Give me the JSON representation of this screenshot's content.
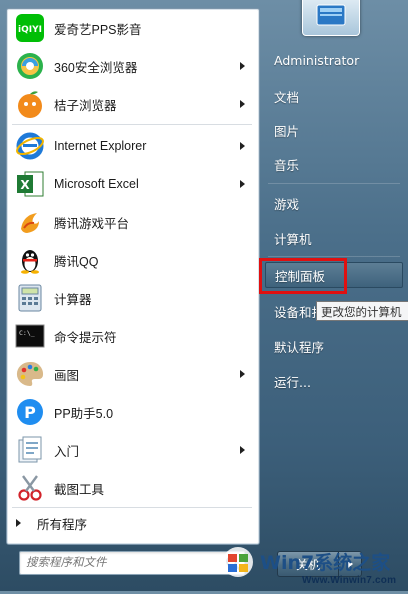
{
  "left_pane": {
    "programs": [
      {
        "id": "iqiyi",
        "label": "爱奇艺PPS影音",
        "icon": "iqiyi-icon",
        "submenu": false
      },
      {
        "id": "360",
        "label": "360安全浏览器",
        "icon": "360-browser-icon",
        "submenu": true
      },
      {
        "id": "orange",
        "label": "桔子浏览器",
        "icon": "orange-browser-icon",
        "submenu": true
      },
      {
        "id": "ie",
        "label": "Internet Explorer",
        "icon": "internet-explorer-icon",
        "submenu": true
      },
      {
        "id": "excel",
        "label": "Microsoft Excel",
        "icon": "excel-icon",
        "submenu": true
      },
      {
        "id": "tgp",
        "label": "腾讯游戏平台",
        "icon": "tencent-game-icon",
        "submenu": false
      },
      {
        "id": "qq",
        "label": "腾讯QQ",
        "icon": "qq-penguin-icon",
        "submenu": false
      },
      {
        "id": "calc",
        "label": "计算器",
        "icon": "calculator-icon",
        "submenu": false
      },
      {
        "id": "cmd",
        "label": "命令提示符",
        "icon": "command-prompt-icon",
        "submenu": false
      },
      {
        "id": "paint",
        "label": "画图",
        "icon": "paint-palette-icon",
        "submenu": true
      },
      {
        "id": "pp",
        "label": "PP助手5.0",
        "icon": "pp-assistant-icon",
        "submenu": false
      },
      {
        "id": "intro",
        "label": "入门",
        "icon": "getting-started-icon",
        "submenu": true
      },
      {
        "id": "snip",
        "label": "截图工具",
        "icon": "snipping-tool-icon",
        "submenu": false
      }
    ],
    "all_programs_label": "所有程序",
    "search_placeholder": "搜索程序和文件"
  },
  "right_pane": {
    "items": [
      {
        "label": "Administrator"
      },
      {
        "label": "文档"
      },
      {
        "label": "图片"
      },
      {
        "label": "音乐"
      },
      {
        "label": "游戏"
      },
      {
        "label": "计算机"
      },
      {
        "label": "控制面板"
      },
      {
        "label": "设备和打"
      },
      {
        "label": "默认程序"
      },
      {
        "label": "运行..."
      }
    ],
    "tooltip": "更改您的计算机"
  },
  "shutdown": {
    "label": "关机"
  },
  "watermark": {
    "brand": "Win7系统之家",
    "domain": "Www.Winwin7.com"
  },
  "colors": {
    "highlight": "#e01010",
    "pane_bg": "#ffffff",
    "menu_bg": "#4b6f8a"
  }
}
